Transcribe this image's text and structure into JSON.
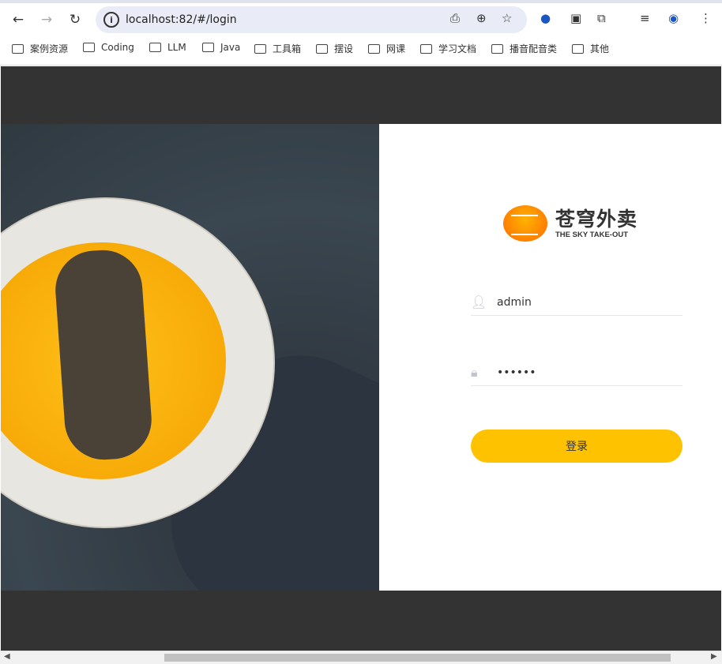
{
  "browser": {
    "url": "localhost:82/#/login",
    "bookmarks": [
      "案例资源",
      "Coding",
      "LLM",
      "Java",
      "工具箱",
      "摆设",
      "网课",
      "学习文档",
      "播音配音类",
      "其他"
    ]
  },
  "logo": {
    "cn": "苍穹外卖",
    "en": "THE SKY TAKE-OUT"
  },
  "login": {
    "username": "admin",
    "password": "••••••",
    "submit_label": "登录"
  },
  "colors": {
    "accent": "#ffc200",
    "background": "#333333"
  }
}
